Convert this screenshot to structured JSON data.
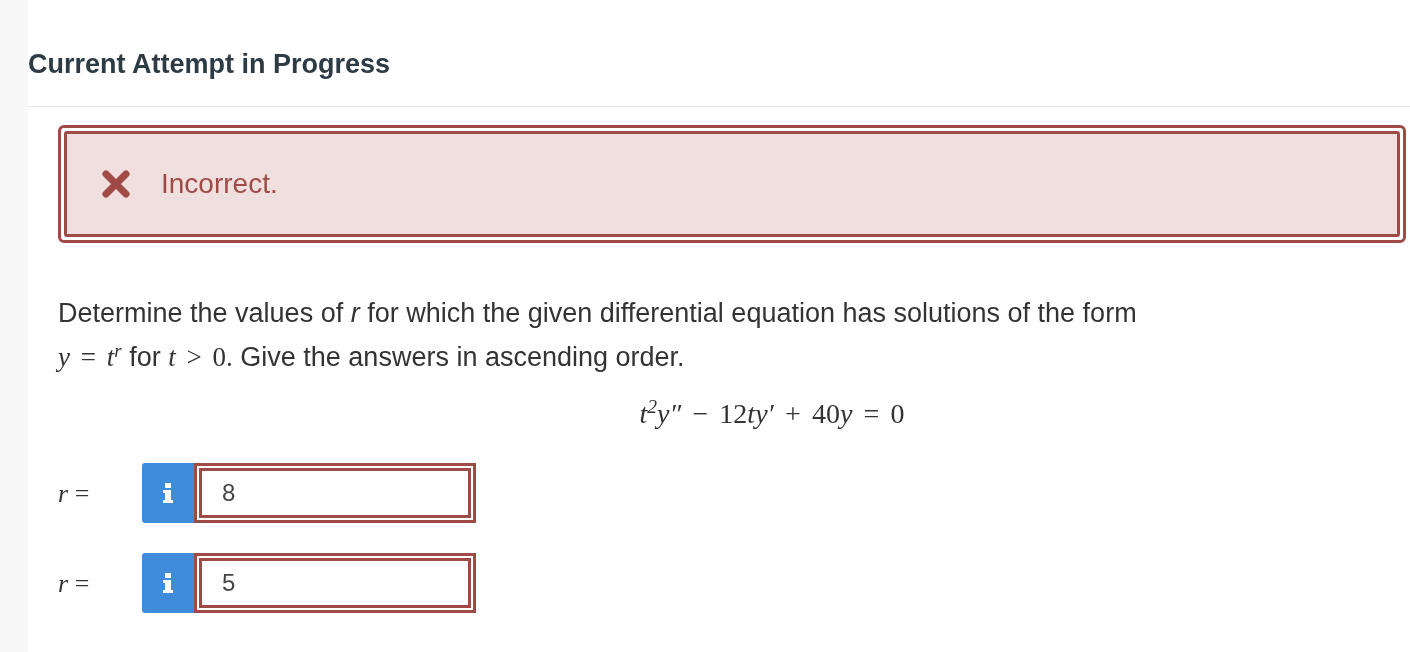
{
  "heading": "Current Attempt in Progress",
  "feedback": {
    "correct": false,
    "message": "Incorrect."
  },
  "question": {
    "segments": [
      {
        "kind": "text",
        "text": "Determine the values of "
      },
      {
        "kind": "var",
        "text": "r"
      },
      {
        "kind": "text",
        "text": " for which the given differential equation has solutions of the form"
      },
      {
        "kind": "break"
      },
      {
        "kind": "mvar",
        "text": "y"
      },
      {
        "kind": "op",
        "text": "="
      },
      {
        "kind": "mvar",
        "text": "t"
      },
      {
        "kind": "sup",
        "text": "r"
      },
      {
        "kind": "text",
        "text": " for "
      },
      {
        "kind": "mvar",
        "text": "t"
      },
      {
        "kind": "op",
        "text": ">"
      },
      {
        "kind": "num",
        "text": "0."
      },
      {
        "kind": "text",
        "text": " Give the answers in ascending order."
      }
    ],
    "equation": [
      {
        "kind": "mvar",
        "text": "t"
      },
      {
        "kind": "sup",
        "text": "2"
      },
      {
        "kind": "mvar",
        "text": "y″"
      },
      {
        "kind": "op",
        "text": "−"
      },
      {
        "kind": "num",
        "text": "12"
      },
      {
        "kind": "mvar",
        "text": "ty′"
      },
      {
        "kind": "op",
        "text": "+"
      },
      {
        "kind": "num",
        "text": "40"
      },
      {
        "kind": "mvar",
        "text": "y"
      },
      {
        "kind": "op",
        "text": "="
      },
      {
        "kind": "num",
        "text": "0"
      }
    ]
  },
  "answers": [
    {
      "label": "*r* =",
      "value": "8",
      "correct": false
    },
    {
      "label": "*r* =",
      "value": "5",
      "correct": false
    }
  ]
}
